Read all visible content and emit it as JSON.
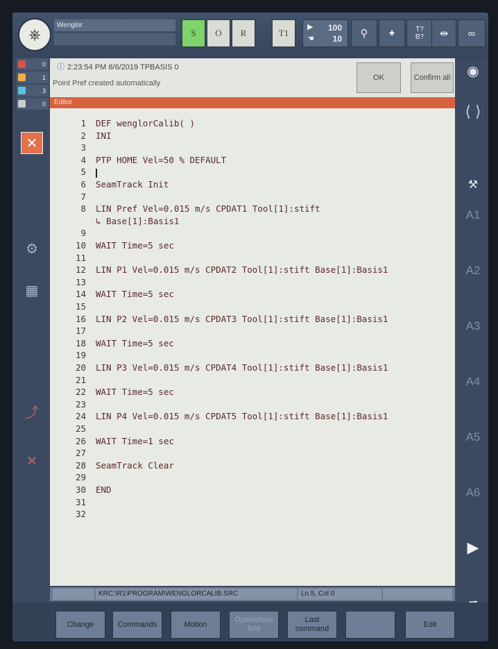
{
  "topbar": {
    "robot_name": "Wenglor",
    "mode_buttons": [
      "S",
      "O",
      "R",
      "T1"
    ],
    "override_program": "100",
    "override_jog": "10",
    "tool_base_label_1": "T?",
    "tool_base_label_2": "B?",
    "infinity_label": "∞"
  },
  "message": {
    "counters": [
      "0",
      "1",
      "3",
      "0"
    ],
    "counter_colors": [
      "#d9534f",
      "#f0ad4e",
      "#5bc0de",
      "#cccccc"
    ],
    "time_text": "2:23:54 PM 8/6/2019 TPBASIS 0",
    "text": "Point Pref created automatically",
    "ok_label": "OK",
    "confirm_all_label": "Confirm all"
  },
  "editor": {
    "title": "Editor",
    "lines": [
      {
        "n": "1",
        "code": "DEF wenglorCalib( )"
      },
      {
        "n": "2",
        "code": "INI"
      },
      {
        "n": "3",
        "code": ""
      },
      {
        "n": "4",
        "code": "PTP HOME Vel=50 % DEFAULT"
      },
      {
        "n": "5",
        "code": ""
      },
      {
        "n": "6",
        "code": "SeamTrack Init"
      },
      {
        "n": "7",
        "code": ""
      },
      {
        "n": "8",
        "code": "LIN Pref Vel=0.015 m/s CPDAT1 Tool[1]:stift"
      },
      {
        "n": "",
        "code": "↳ Base[1]:Basis1"
      },
      {
        "n": "9",
        "code": ""
      },
      {
        "n": "10",
        "code": "WAIT Time=5 sec"
      },
      {
        "n": "11",
        "code": ""
      },
      {
        "n": "12",
        "code": "LIN P1 Vel=0.015 m/s CPDAT2 Tool[1]:stift Base[1]:Basis1"
      },
      {
        "n": "13",
        "code": ""
      },
      {
        "n": "14",
        "code": "WAIT Time=5 sec"
      },
      {
        "n": "15",
        "code": ""
      },
      {
        "n": "16",
        "code": "LIN P2 Vel=0.015 m/s CPDAT3 Tool[1]:stift Base[1]:Basis1"
      },
      {
        "n": "17",
        "code": ""
      },
      {
        "n": "18",
        "code": "WAIT Time=5 sec"
      },
      {
        "n": "19",
        "code": ""
      },
      {
        "n": "20",
        "code": "LIN P3 Vel=0.015 m/s CPDAT4 Tool[1]:stift Base[1]:Basis1"
      },
      {
        "n": "21",
        "code": ""
      },
      {
        "n": "22",
        "code": "WAIT Time=5 sec"
      },
      {
        "n": "23",
        "code": ""
      },
      {
        "n": "24",
        "code": "LIN P4 Vel=0.015 m/s CPDAT5 Tool[1]:stift Base[1]:Basis1"
      },
      {
        "n": "25",
        "code": ""
      },
      {
        "n": "26",
        "code": "WAIT Time=1 sec"
      },
      {
        "n": "27",
        "code": ""
      },
      {
        "n": "28",
        "code": "SeamTrack Clear"
      },
      {
        "n": "29",
        "code": ""
      },
      {
        "n": "30",
        "code": "END"
      },
      {
        "n": "31",
        "code": ""
      },
      {
        "n": "32",
        "code": ""
      }
    ],
    "file_path": "KRC:\\R1\\PROGRAM\\WENGLORCALIB.SRC",
    "cursor_pos": "Ln 5, Col 0"
  },
  "side_right": {
    "axes": [
      "A1",
      "A2",
      "A3",
      "A4",
      "A5",
      "A6"
    ]
  },
  "softkeys": {
    "change": "Change",
    "commands": "Commands",
    "motion": "Motion",
    "fold": "Open/close fold",
    "last_command": "Last command",
    "edit": "Edit"
  }
}
